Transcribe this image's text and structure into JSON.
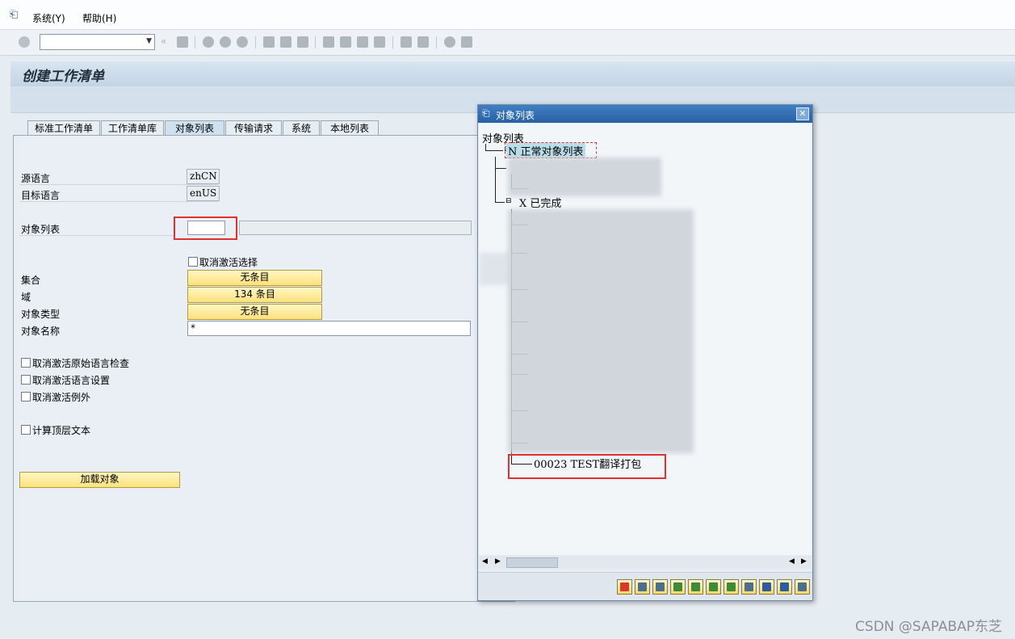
{
  "menu": {
    "system": "系统(Y)",
    "help": "帮助(H)"
  },
  "page_title": "创建工作清单",
  "tabs": [
    "标准工作清单",
    "工作清单库",
    "对象列表",
    "传输请求",
    "系统",
    "本地列表"
  ],
  "form": {
    "source_lang_label": "源语言",
    "source_lang_value": "zhCN",
    "target_lang_label": "目标语言",
    "target_lang_value": "enUS",
    "object_list_label": "对象列表",
    "object_list_value": "",
    "object_list_desc": "",
    "deactivate_selection_label": "取消激活选择",
    "set_label": "集合",
    "set_value": "无条目",
    "domain_label": "域",
    "domain_value": "134 条目",
    "object_type_label": "对象类型",
    "object_type_value": "无条目",
    "object_name_label": "对象名称",
    "object_name_value": "*",
    "check1": "取消激活原始语言检查",
    "check2": "取消激活语言设置",
    "check3": "取消激活例外",
    "check4": "计算顶层文本",
    "load_button": "加载对象"
  },
  "dialog": {
    "title": "对象列表",
    "tree_header": "对象列表",
    "node_normal": "N 正常对象列表",
    "node_done": "X 已完成",
    "node_last": "00023 TEST翻译打包"
  },
  "watermark": "CSDN @SAPABAP东芝"
}
